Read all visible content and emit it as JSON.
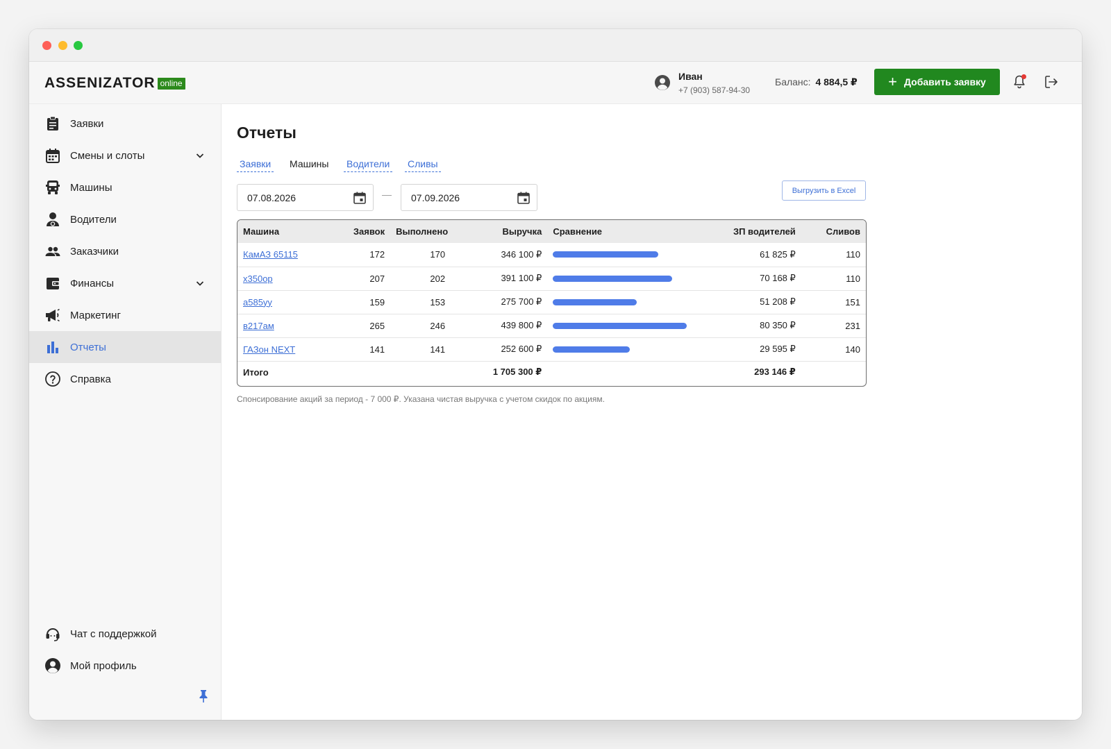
{
  "app": {
    "logo_main": "ASSENIZATOR",
    "logo_badge": "online"
  },
  "header": {
    "user_name": "Иван",
    "user_phone": "+7 (903) 587-94-30",
    "balance_label": "Баланс:",
    "balance_value": "4 884,5 ₽",
    "add_button_label": "Добавить заявку",
    "bell_icon": "bell-icon",
    "logout_icon": "logout-icon",
    "accent_color": "#21881f",
    "notification_color": "#e53935"
  },
  "sidebar": {
    "items": [
      {
        "label": "Заявки",
        "icon": "clipboard-icon"
      },
      {
        "label": "Смены и слоты",
        "icon": "calendar-icon",
        "expandable": true
      },
      {
        "label": "Машины",
        "icon": "truck-icon"
      },
      {
        "label": "Водители",
        "icon": "driver-icon"
      },
      {
        "label": "Заказчики",
        "icon": "customers-icon"
      },
      {
        "label": "Финансы",
        "icon": "wallet-icon",
        "expandable": true
      },
      {
        "label": "Маркетинг",
        "icon": "megaphone-icon"
      },
      {
        "label": "Отчеты",
        "icon": "bar-chart-icon",
        "active": true
      },
      {
        "label": "Справка",
        "icon": "help-icon"
      }
    ],
    "bottom_items": [
      {
        "label": "Чат с поддержкой",
        "icon": "support-icon"
      },
      {
        "label": "Мой профиль",
        "icon": "profile-icon"
      }
    ],
    "active_color": "#3d6fd6"
  },
  "main": {
    "title": "Отчеты",
    "tabs": [
      {
        "label": "Заявки",
        "active": false
      },
      {
        "label": "Машины",
        "active": true
      },
      {
        "label": "Водители",
        "active": false
      },
      {
        "label": "Сливы",
        "active": false
      }
    ],
    "date_from": "07.08.2026",
    "date_to": "07.09.2026",
    "separator": "—",
    "export_label": "Выгрузить в Excel",
    "table": {
      "columns": [
        "Машина",
        "Заявок",
        "Выполнено",
        "Выручка",
        "Сравнение",
        "ЗП водителей",
        "Сливов"
      ],
      "rows": [
        {
          "machine": "КамАЗ 65115",
          "requests": "172",
          "completed": "170",
          "revenue": "346 100 ₽",
          "revenue_value": 346100,
          "salary": "61 825 ₽",
          "drains": "110"
        },
        {
          "machine": "х350ор",
          "requests": "207",
          "completed": "202",
          "revenue": "391 100 ₽",
          "revenue_value": 391100,
          "salary": "70 168 ₽",
          "drains": "110"
        },
        {
          "machine": "а585уу",
          "requests": "159",
          "completed": "153",
          "revenue": "275 700 ₽",
          "revenue_value": 275700,
          "salary": "51 208 ₽",
          "drains": "151"
        },
        {
          "machine": "в217ам",
          "requests": "265",
          "completed": "246",
          "revenue": "439 800 ₽",
          "revenue_value": 439800,
          "salary": "80 350 ₽",
          "drains": "231"
        },
        {
          "machine": "ГАЗон NEXT",
          "requests": "141",
          "completed": "141",
          "revenue": "252 600 ₽",
          "revenue_value": 252600,
          "salary": "29 595 ₽",
          "drains": "140"
        }
      ],
      "total_label": "Итого",
      "total_revenue": "1 705 300 ₽",
      "total_salary": "293 146 ₽",
      "bar_color": "#4f7ce8"
    },
    "note": "Спонсирование акций за период - 7 000 ₽. Указана чистая выручка с учетом скидок по акциям."
  }
}
